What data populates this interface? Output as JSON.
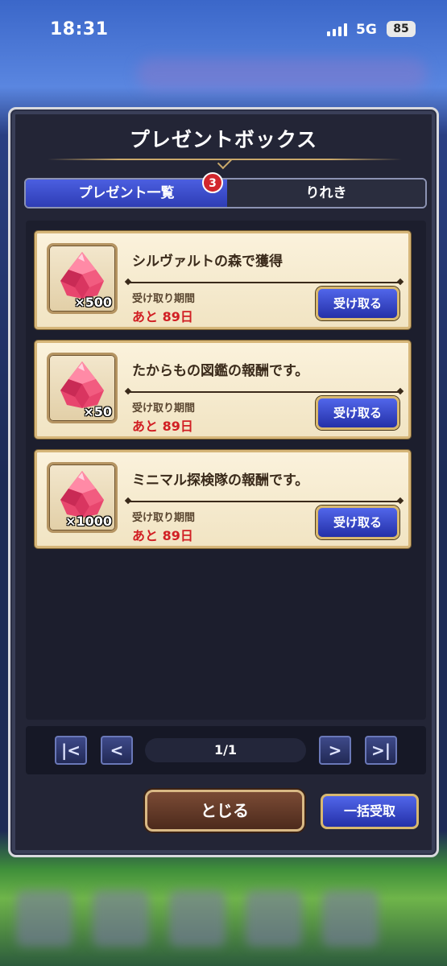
{
  "status_bar": {
    "time": "18:31",
    "network": "5G",
    "battery": "85"
  },
  "dialog": {
    "title": "プレゼントボックス",
    "tabs": [
      {
        "label": "プレゼント一覧",
        "active": true
      },
      {
        "label": "りれき",
        "active": false
      }
    ],
    "badge_count": "3",
    "period_label": "受け取り期間",
    "receive_label": "受け取る",
    "items": [
      {
        "title": "シルヴァルトの森で獲得",
        "quantity": "×500",
        "remaining": "あと 89日"
      },
      {
        "title": "たからもの図鑑の報酬です。",
        "quantity": "×50",
        "remaining": "あと 89日"
      },
      {
        "title": "ミニマル探検隊の報酬です。",
        "quantity": "×1000",
        "remaining": "あと 89日"
      }
    ],
    "pager": {
      "first": "|<",
      "prev": "<",
      "next": ">",
      "last": ">|",
      "page_text": "1/1"
    },
    "close_label": "とじる",
    "bulk_receive_label": "一括受取"
  },
  "colors": {
    "accent_blue": "#2e3db5",
    "remaining_red": "#d11f24",
    "gold": "#d8b86f"
  }
}
